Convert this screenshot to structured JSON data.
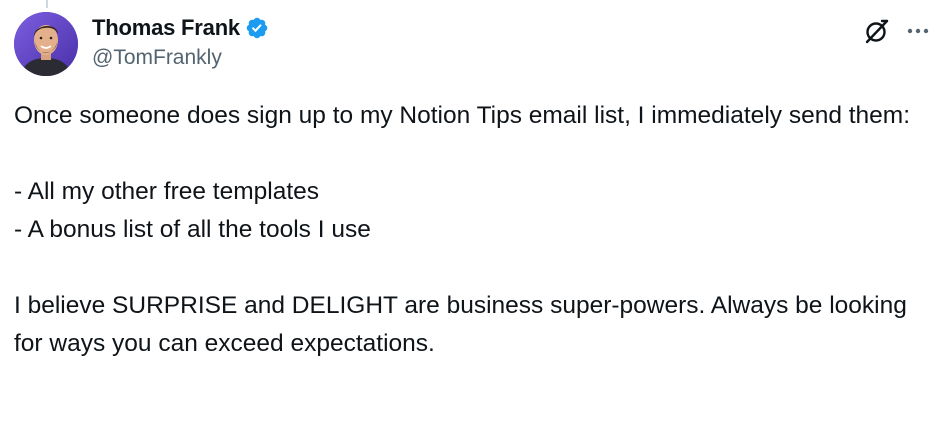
{
  "tweet": {
    "author": {
      "display_name": "Thomas Frank",
      "handle": "@TomFrankly",
      "verified": true,
      "avatar_icon": "avatar-photo"
    },
    "actions": {
      "grok_icon": "grok-icon",
      "more_icon": "more-options-icon"
    },
    "body": {
      "paragraph_1": "Once someone does sign up to my Notion Tips email list, I immediately send them:",
      "list_item_1": "- All my other free templates",
      "list_item_2": "- A bonus list of all the tools I use",
      "paragraph_2": "I believe SURPRISE and DELIGHT are business super-powers. Always be looking for ways you can exceed expectations."
    }
  },
  "colors": {
    "text": "#0f1419",
    "secondary_text": "#536471",
    "verified_badge": "#1d9bf0",
    "background": "#ffffff"
  }
}
